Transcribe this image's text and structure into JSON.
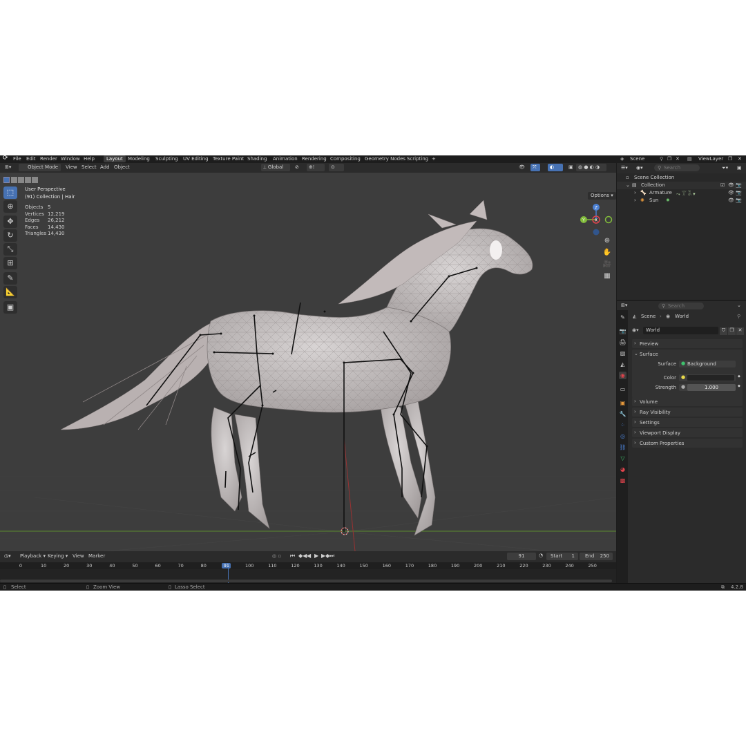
{
  "menu": {
    "items": [
      "File",
      "Edit",
      "Render",
      "Window",
      "Help"
    ],
    "workspaces": [
      "Layout",
      "Modeling",
      "Sculpting",
      "UV Editing",
      "Texture Paint",
      "Shading",
      "Animation",
      "Rendering",
      "Compositing",
      "Geometry Nodes",
      "Scripting"
    ],
    "add_tab": "+",
    "scene_label": "Scene",
    "view_layer_label": "ViewLayer"
  },
  "viewport_header": {
    "mode": "Object Mode",
    "menus": [
      "View",
      "Select",
      "Add",
      "Object"
    ],
    "transform_orientation": "Global",
    "options_label": "Options"
  },
  "viewport": {
    "perspective": "User Perspective",
    "context": "(91) Collection | Hair",
    "stats": [
      {
        "label": "Objects",
        "value": "5"
      },
      {
        "label": "Vertices",
        "value": "12,219"
      },
      {
        "label": "Edges",
        "value": "26,212"
      },
      {
        "label": "Faces",
        "value": "14,430"
      },
      {
        "label": "Triangles",
        "value": "14,430"
      }
    ],
    "gizmo_axes": [
      "Z",
      "Y",
      "X"
    ]
  },
  "timeline": {
    "menus": [
      "Playback",
      "Keying",
      "View",
      "Marker"
    ],
    "current_frame": "91",
    "start_label": "Start",
    "start_value": "1",
    "end_label": "End",
    "end_value": "250",
    "ruler": [
      "0",
      "10",
      "20",
      "30",
      "40",
      "50",
      "60",
      "70",
      "80",
      "91",
      "100",
      "110",
      "120",
      "130",
      "140",
      "150",
      "160",
      "170",
      "180",
      "190",
      "200",
      "210",
      "220",
      "230",
      "240",
      "250"
    ]
  },
  "statusbar": {
    "hints": [
      "Select",
      "Zoom View",
      "Lasso Select"
    ],
    "version": "4.2.8"
  },
  "outliner": {
    "search_placeholder": "Search",
    "scene_collection": "Scene Collection",
    "collection": "Collection",
    "items": [
      "Armature",
      "Sun"
    ]
  },
  "properties": {
    "search_placeholder": "Search",
    "breadcrumb": [
      "Scene",
      "World"
    ],
    "world_name": "World",
    "panels_top": [
      "Preview"
    ],
    "surface": {
      "title": "Surface",
      "surface_label": "Surface",
      "surface_value": "Background",
      "color_label": "Color",
      "strength_label": "Strength",
      "strength_value": "1.000"
    },
    "panels_bottom": [
      "Volume",
      "Ray Visibility",
      "Settings",
      "Viewport Display",
      "Custom Properties"
    ]
  },
  "colors": {
    "accent": "#4772b3",
    "viewport_bg": "#3d3d3d",
    "x_axis": "#e0434c",
    "y_axis": "#82bc3b",
    "z_axis": "#4b7fd1"
  }
}
